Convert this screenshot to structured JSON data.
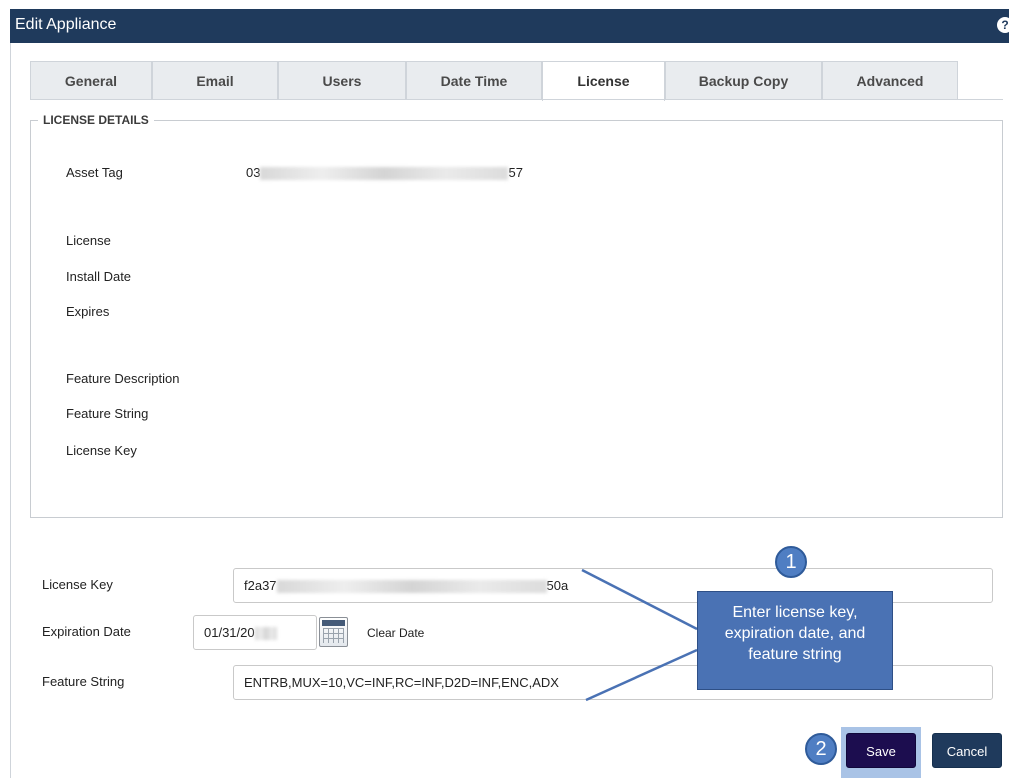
{
  "window": {
    "title": "Edit Appliance",
    "help_icon": "?"
  },
  "tabs": [
    {
      "label": "General",
      "active": false
    },
    {
      "label": "Email",
      "active": false
    },
    {
      "label": "Users",
      "active": false
    },
    {
      "label": "Date Time",
      "active": false
    },
    {
      "label": "License",
      "active": true
    },
    {
      "label": "Backup Copy",
      "active": false
    },
    {
      "label": "Advanced",
      "active": false
    }
  ],
  "license_details": {
    "legend": "LICENSE DETAILS",
    "asset_tag": {
      "label": "Asset Tag",
      "value_start": "03",
      "value_end": "57"
    },
    "license_label": "License",
    "install_date_label": "Install Date",
    "expires_label": "Expires",
    "feature_description_label": "Feature Description",
    "feature_string_label": "Feature String",
    "license_key_label": "License Key"
  },
  "form": {
    "license_key": {
      "label": "License Key",
      "value_start": "f2a37",
      "value_end": "50a"
    },
    "expiration_date": {
      "label": "Expiration Date",
      "value": "01/31/20",
      "clear_label": "Clear Date",
      "icon": "calendar-icon"
    },
    "feature_string": {
      "label": "Feature String",
      "value": "ENTRB,MUX=10,VC=INF,RC=INF,D2D=INF,ENC,ADX"
    }
  },
  "annotations": {
    "marker_1": "1",
    "marker_2": "2",
    "callout_text": "Enter license key, expiration date, and feature string",
    "color": "#4a72b4"
  },
  "buttons": {
    "save": "Save",
    "cancel": "Cancel"
  },
  "colors": {
    "titlebar": "#1f3a5c",
    "save_button": "#1c0d4f",
    "cancel_button": "#1f3a5c"
  }
}
